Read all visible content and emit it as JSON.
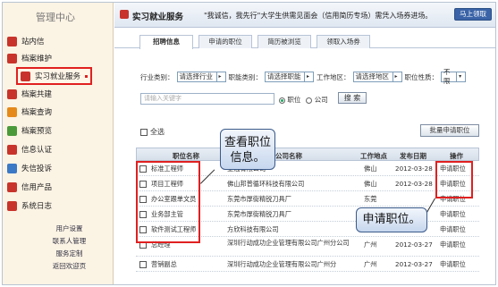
{
  "sidebar": {
    "title": "管理中心",
    "items": [
      {
        "label": "站内信",
        "color": "#c8342b"
      },
      {
        "label": "档案维护",
        "color": "#c8342b"
      },
      {
        "label": "实习就业服务",
        "color": "#c8342b"
      },
      {
        "label": "档案共建",
        "color": "#c8342b"
      },
      {
        "label": "档案查询",
        "color": "#e58a1a"
      },
      {
        "label": "档案预览",
        "color": "#4a9a3a"
      },
      {
        "label": "信息认证",
        "color": "#c8342b"
      },
      {
        "label": "失信投诉",
        "color": "#3b78c6"
      },
      {
        "label": "信用产品",
        "color": "#c8342b"
      },
      {
        "label": "系统日志",
        "color": "#c8342b"
      }
    ],
    "sub_links": [
      "用户设置",
      "联系人管理",
      "服务定制",
      "返回欢迎页"
    ]
  },
  "header": {
    "title": "实习就业服务",
    "message": "\"我诚信，我先行\"大学生供需见面会（信用简历专场）需凭入场券进场。",
    "signup_button": "马上领取"
  },
  "tabs": [
    "招聘信息",
    "申请的职位",
    "简历被浏览",
    "领取入场券"
  ],
  "filters": {
    "industry_label": "行业类别：",
    "industry_value": "请选择行业",
    "job_label": "职能类别：",
    "job_value": "请选择职能",
    "area_label": "工作地区：",
    "area_value": "请选择地区",
    "nature_label": "职位性质：",
    "nature_value": "不限"
  },
  "search": {
    "placeholder": "请输入关键字",
    "radio_job": "职位",
    "radio_company": "公司",
    "button": "搜 索"
  },
  "select_all": "全选",
  "batch_apply": "批量申请职位",
  "table": {
    "headers": [
      "职位名称",
      "公司名称",
      "工作地点",
      "发布日期",
      "操作"
    ],
    "rows": [
      {
        "name": "标准工程师",
        "company": "金冠有限公司",
        "place": "佛山",
        "date": "2012-03-28",
        "op": "申请职位"
      },
      {
        "name": "项目工程师",
        "company": "佛山邦普循环科技有限公司",
        "place": "佛山",
        "date": "2012-03-28",
        "op": "申请职位"
      },
      {
        "name": "办公室跟单文员",
        "company": "东莞市厚街精锐刀具厂",
        "place": "东莞",
        "date": "",
        "op": "申请职位"
      },
      {
        "name": "业务部主管",
        "company": "东莞市厚街精锐刀具厂",
        "place": "",
        "date": "",
        "op": "申请职位"
      },
      {
        "name": "软件测试工程师",
        "company": "方欣科技有限公司",
        "place": "",
        "date": "",
        "op": "申请职位"
      },
      {
        "name": "总经理",
        "company": "深圳行动成功企业管理有限公司广州分公司",
        "place": "广州",
        "date": "2012-03-27",
        "op": "申请职位"
      },
      {
        "name": "营销副总",
        "company": "深圳行动成功企业管理有限公司广州分",
        "place": "广州",
        "date": "2012-03-27",
        "op": "申请职位"
      }
    ]
  },
  "annotations": {
    "view_info": "查看职位信息。",
    "apply_job": "申请职位。"
  }
}
